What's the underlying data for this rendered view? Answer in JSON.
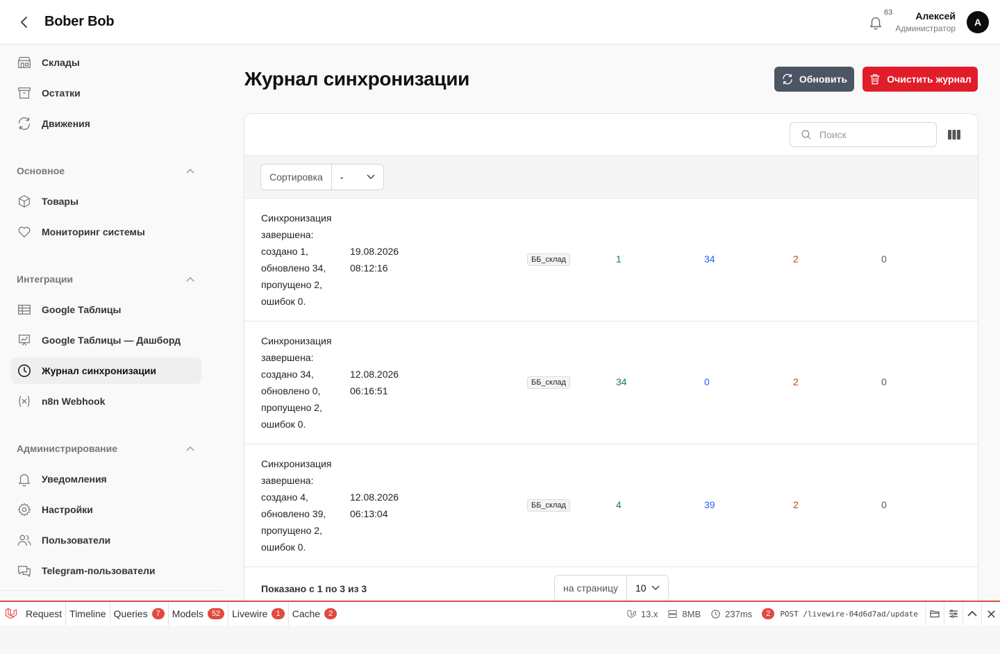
{
  "header": {
    "brand": "Bober Bob",
    "notifications_count": "63",
    "user_name": "Алексей",
    "user_role": "Администратор",
    "avatar_letter": "A"
  },
  "sidebar": {
    "top_items": [
      {
        "label": "Склады",
        "icon": "warehouse-icon"
      },
      {
        "label": "Остатки",
        "icon": "archive-icon"
      },
      {
        "label": "Движения",
        "icon": "refresh-icon"
      }
    ],
    "groups": [
      {
        "title": "Основное",
        "items": [
          {
            "label": "Товары",
            "icon": "cube-icon"
          },
          {
            "label": "Мониторинг системы",
            "icon": "heart-icon"
          }
        ]
      },
      {
        "title": "Интеграции",
        "items": [
          {
            "label": "Google Таблицы",
            "icon": "table-icon"
          },
          {
            "label": "Google Таблицы — Дашборд",
            "icon": "chart-icon"
          },
          {
            "label": "Журнал синхронизации",
            "icon": "clock-icon",
            "active": true
          },
          {
            "label": "n8n Webhook",
            "icon": "variable-icon"
          }
        ]
      },
      {
        "title": "Администрирование",
        "items": [
          {
            "label": "Уведомления",
            "icon": "bell-icon"
          },
          {
            "label": "Настройки",
            "icon": "gear-icon"
          },
          {
            "label": "Пользователи",
            "icon": "users-icon"
          },
          {
            "label": "Telegram-пользователи",
            "icon": "chat-icon"
          }
        ]
      }
    ]
  },
  "main": {
    "title": "Журнал синхронизации",
    "refresh_label": "Обновить",
    "clear_label": "Очистить журнал",
    "search_placeholder": "Поиск",
    "sort_label": "Сортировка",
    "sort_value": "-",
    "rows": [
      {
        "message": "Синхронизация завершена: создано 1, обновлено 34, пропущено 2, ошибок 0.",
        "date": "19.08.2026",
        "time": "08:12:16",
        "warehouse": "ББ_склад",
        "created": "1",
        "updated": "34",
        "skipped": "2",
        "errors": "0"
      },
      {
        "message": "Синхронизация завершена: создано 34, обновлено 0, пропущено 2, ошибок 0.",
        "date": "12.08.2026",
        "time": "06:16:51",
        "warehouse": "ББ_склад",
        "created": "34",
        "updated": "0",
        "skipped": "2",
        "errors": "0"
      },
      {
        "message": "Синхронизация завершена: создано 4, обновлено 39, пропущено 2, ошибок 0.",
        "date": "12.08.2026",
        "time": "06:13:04",
        "warehouse": "ББ_склад",
        "created": "4",
        "updated": "39",
        "skipped": "2",
        "errors": "0"
      }
    ],
    "footer_info": "Показано с 1 по 3 из 3",
    "per_page_label": "на страницу",
    "per_page_value": "10"
  },
  "debugbar": {
    "tabs": [
      {
        "label": "Request"
      },
      {
        "label": "Timeline"
      },
      {
        "label": "Queries",
        "count": "7"
      },
      {
        "label": "Models",
        "count": "52"
      },
      {
        "label": "Livewire",
        "count": "1"
      },
      {
        "label": "Cache",
        "count": "2"
      }
    ],
    "version": "13.x",
    "memory": "8MB",
    "duration": "237ms",
    "request_count": "2",
    "request": "POST /livewire-04d6d7ad/update"
  },
  "colors": {
    "refresh_button": "#4b5563",
    "clear_button": "#e11d2a",
    "created": "#15803d",
    "updated": "#2563eb",
    "skipped": "#c2410c",
    "debug_accent": "#e2493f"
  }
}
